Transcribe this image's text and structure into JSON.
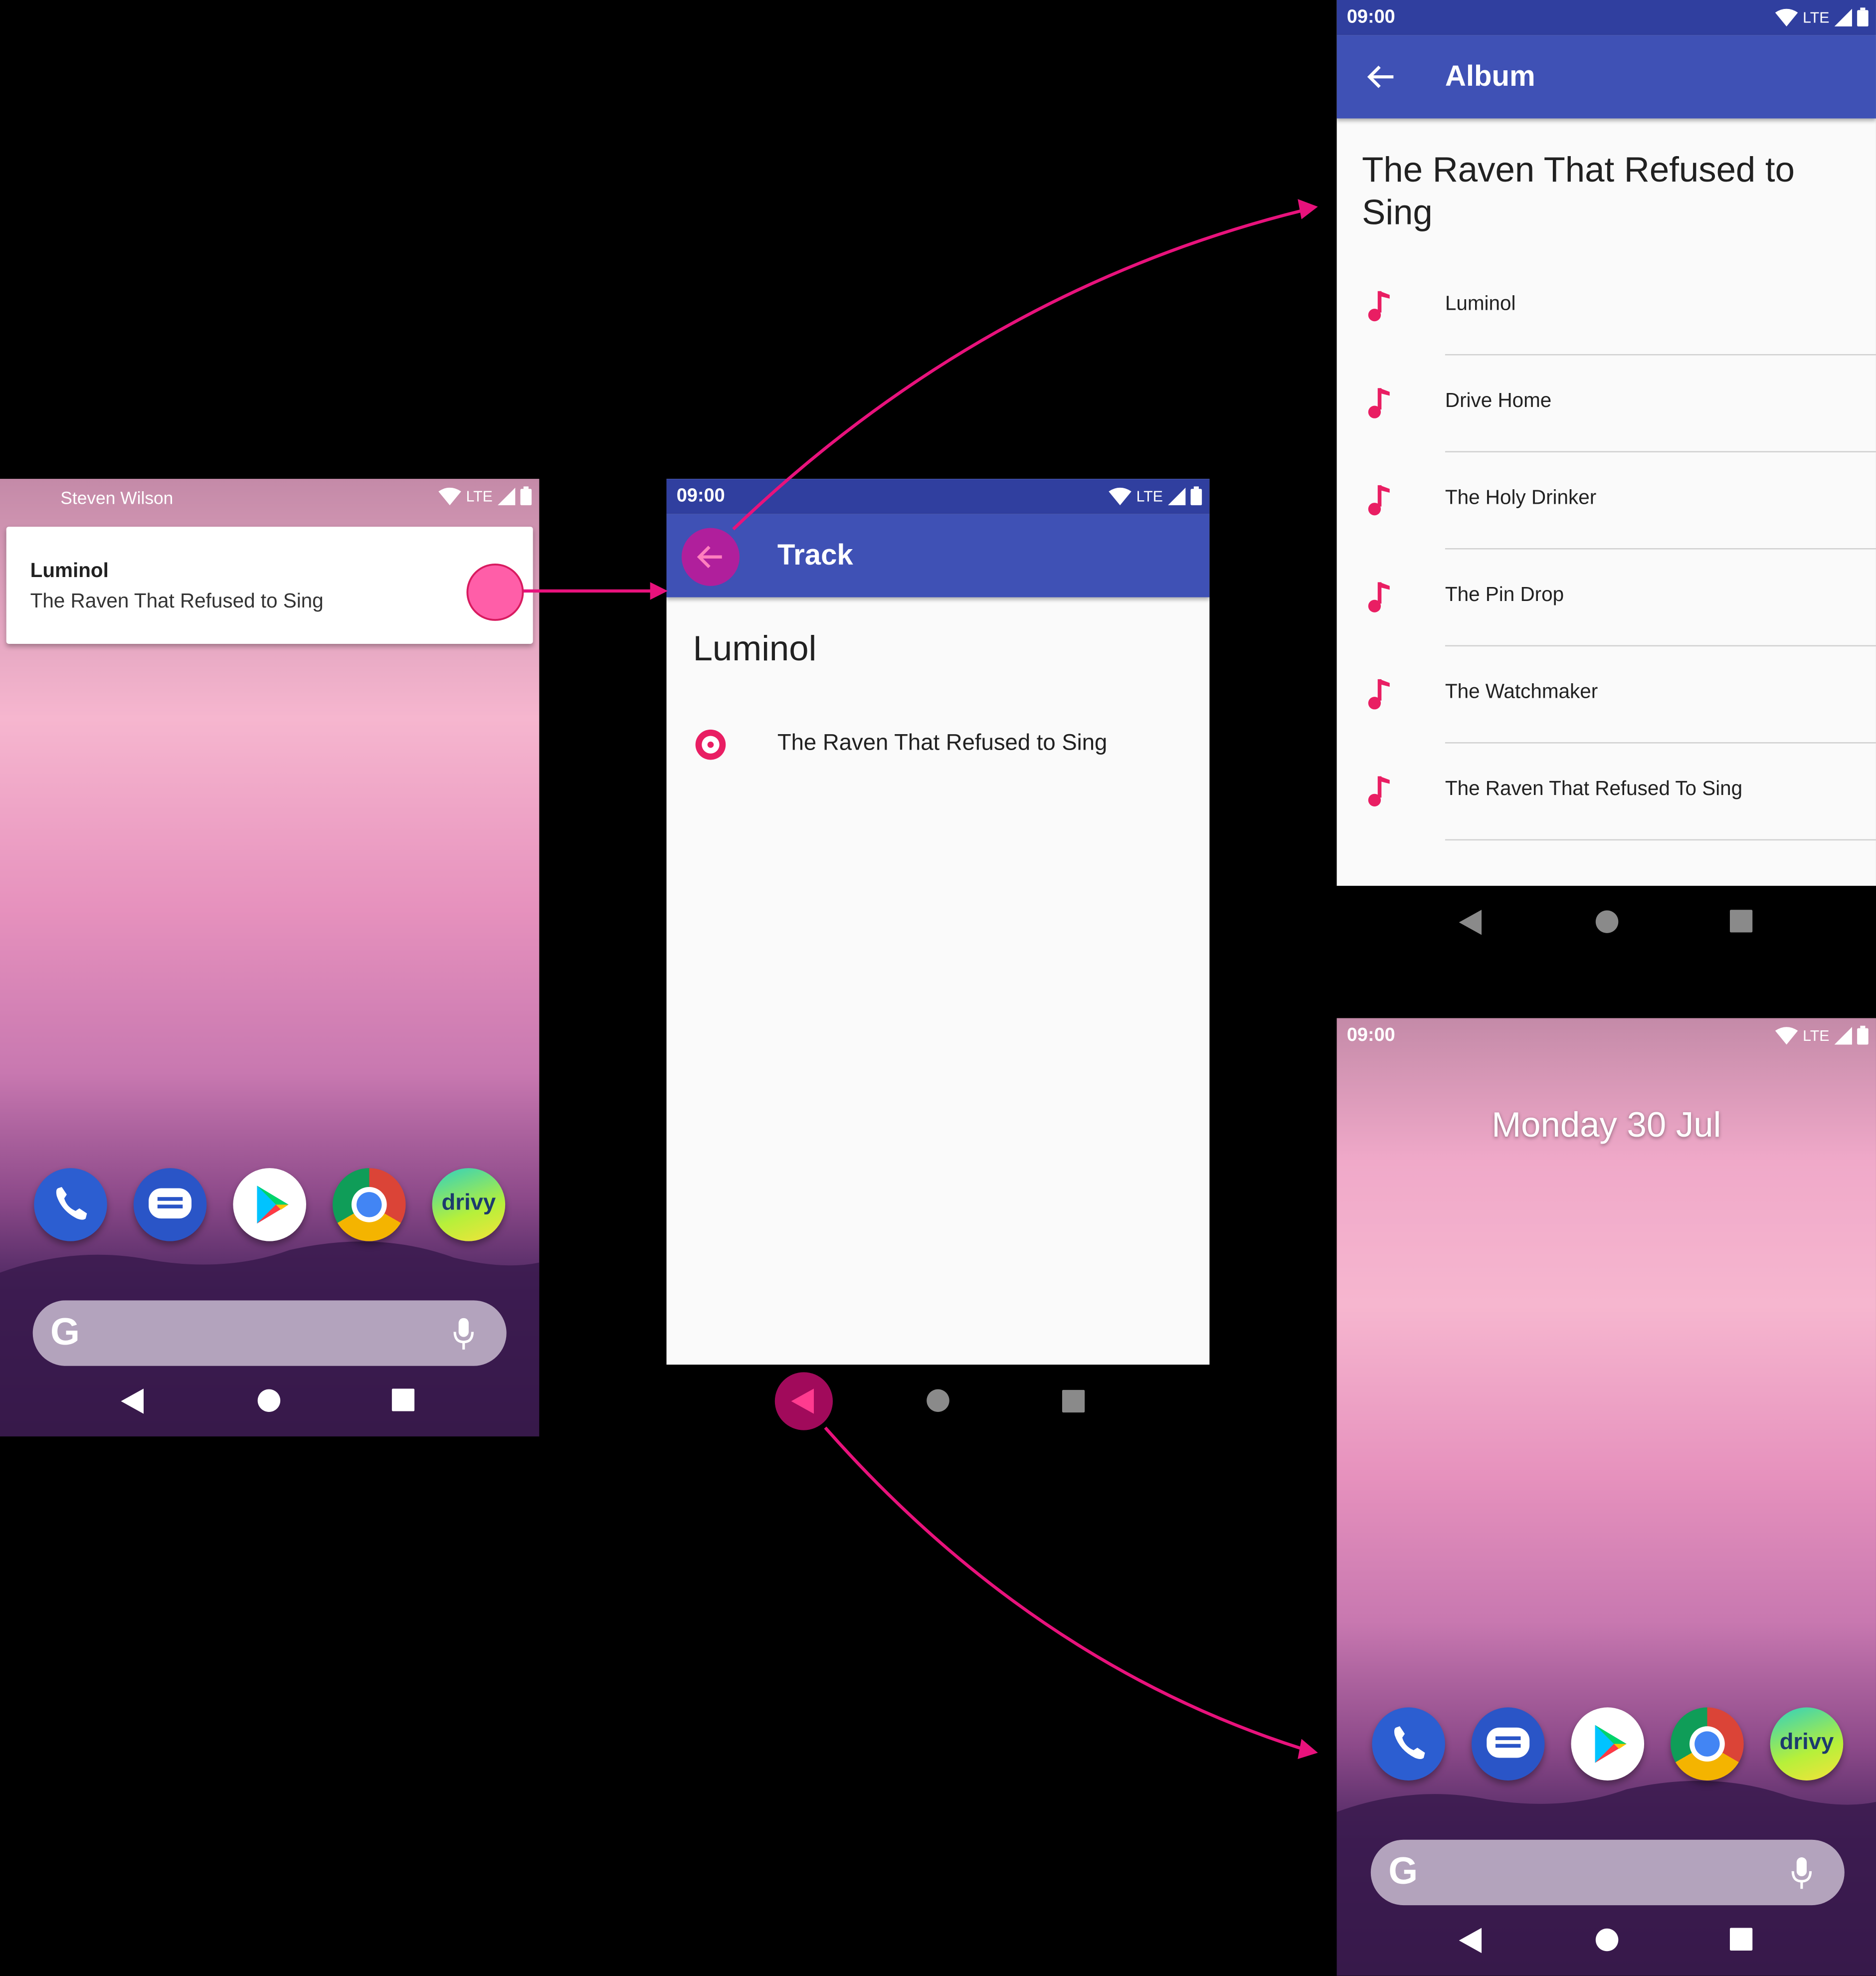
{
  "colors": {
    "primary": "#3f51b5",
    "primary_dark": "#303f9f",
    "accent": "#e91e63",
    "highlight": "#ff4d9e",
    "arrow": "#e8127c"
  },
  "home_notification": {
    "status_label": "Steven Wilson",
    "network": "LTE",
    "notification_title": "Luminol",
    "notification_text": "The Raven That Refused to Sing"
  },
  "track_screen": {
    "time": "09:00",
    "network": "LTE",
    "title": "Track",
    "track_name": "Luminol",
    "album_row_label": "The Raven That Refused to Sing"
  },
  "album_screen": {
    "time": "09:00",
    "network": "LTE",
    "title": "Album",
    "album_name": "The Raven That Refused to Sing",
    "tracks": [
      "Luminol",
      "Drive Home",
      "The Holy Drinker",
      "The Pin Drop",
      "The Watchmaker",
      "The Raven That Refused To Sing"
    ]
  },
  "home_screen": {
    "time": "09:00",
    "network": "LTE",
    "date": "Monday 30 Jul"
  },
  "dock_apps": [
    "phone-icon",
    "messages-icon",
    "play-store-icon",
    "chrome-icon",
    "drivy-icon"
  ],
  "drivy_label": "drivy"
}
